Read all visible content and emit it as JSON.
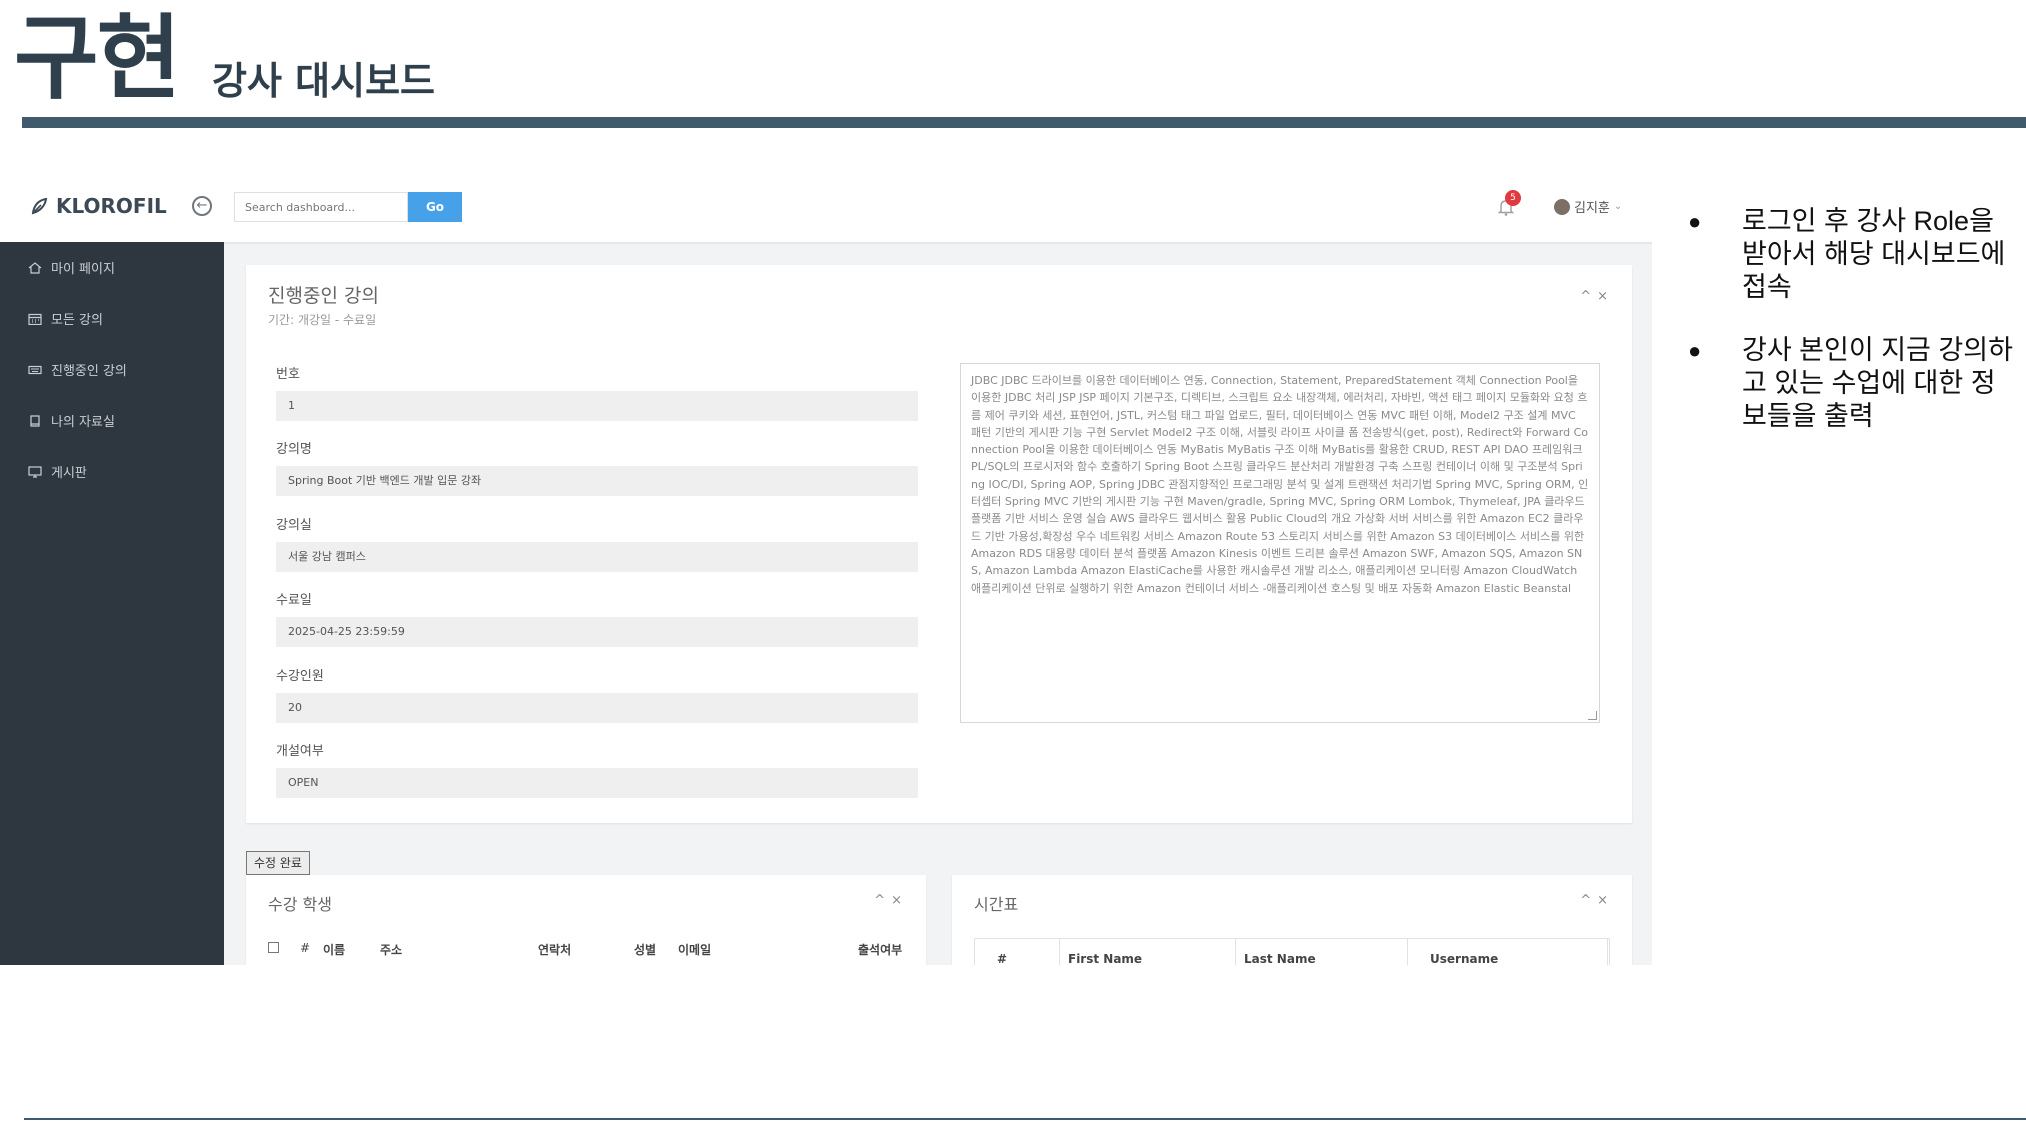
{
  "slide": {
    "title": "구현",
    "subtitle": "강사 대시보드",
    "bullets": [
      "로그인 후 강사 Role을 받아서 해당 대시보드에 접속",
      "강사 본인이 지금 강의하고 있는 수업에 대한 정보들을 출력"
    ]
  },
  "topnav": {
    "logo": "KLOROFIL",
    "search_placeholder": "Search dashboard...",
    "go_label": "Go",
    "notification_count": "5",
    "user_name": "김지훈"
  },
  "sidebar": {
    "items": [
      {
        "label": "마이 페이지",
        "icon": "home-icon"
      },
      {
        "label": "모든 강의",
        "icon": "calendar-icon"
      },
      {
        "label": "진행중인 강의",
        "icon": "keyboard-icon"
      },
      {
        "label": "나의 자료실",
        "icon": "book-icon"
      },
      {
        "label": "게시판",
        "icon": "monitor-icon"
      }
    ]
  },
  "course_panel": {
    "title": "진행중인 강의",
    "subtitle": "기간: 개강일 - 수료일",
    "fields": [
      {
        "label": "번호",
        "value": "1"
      },
      {
        "label": "강의명",
        "value": "Spring Boot 기반 백엔드 개발 입문 강좌"
      },
      {
        "label": "강의실",
        "value": "서울 강남 캠퍼스"
      },
      {
        "label": "수료일",
        "value": "2025-04-25 23:59:59"
      },
      {
        "label": "수강인원",
        "value": "20"
      },
      {
        "label": "개설여부",
        "value": "OPEN"
      }
    ],
    "curriculum": "JDBC JDBC 드라이브를 이용한 데이터베이스 연동, Connection, Statement, PreparedStatement 객체 Connection Pool을 이용한 JDBC 처리    JSP  JSP 페이지 기본구조, 디렉티브, 스크립트 요소    내장객체, 에러처리, 자바빈, 액션 태그    페이지 모듈화와 요청 흐름 제어    쿠키와 세션, 표현언어, JSTL, 커스텀 태그    파일 업로드, 필터, 데이터베이스 연동    MVC 패턴 이해, Model2 구조 설계    MVC 패턴 기반의 게시판 기능 구현    Servlet  Model2 구조 이해, 서블릿 라이프 사이클    폼 전송방식(get, post), Redirect와 Forward    Connection Pool을 이용한 데이터베이스 연동    MyBatis  MyBatis 구조 이해    MyBatis를 활용한 CRUD, REST API    DAO 프레임워크    PL/SQL의 프로시저와 함수 호출하기    Spring Boot  스프링 클라우드 분산처리 개발환경 구축    스프링 컨테이너 이해 및 구조분석    Spring IOC/DI, Spring AOP, Spring JDBC    관점지향적인 프로그래밍 분석 및 설계    트랜잭션 처리기법    Spring MVC, Spring ORM, 인터셉터    Spring MVC 기반의 게시판 기능 구현    Maven/gradle, Spring MVC, Spring ORM    Lombok, Thymeleaf, JPA    클라우드 플랫폼 기반 서비스 운영 실습  AWS 클라우드 웹서비스 활용  Public Cloud의 개요    가상화 서버 서비스를 위한 Amazon EC2    클라우드 기반 가용성,확장성 우수 네트워킹 서비스 Amazon Route 53    스토리지 서비스를 위한 Amazon S3    데이터베이스 서비스를 위한 Amazon RDS    대용량 데이터 분석 플랫폼 Amazon Kinesis    이벤트 드리븐 솔루션 Amazon SWF, Amazon SQS, Amazon SNS, Amazon Lambda    Amazon ElastiCache를 사용한 캐시솔루션 개발    리소스, 애플리케이션 모니터링 Amazon CloudWatch    애플리케이션 단위로 실행하기 위한 Amazon 컨테이너 서비스    -애플리케이션 호스팅 및 배포 자동화 Amazon Elastic Beanstal"
  },
  "done_button": "수정 완료",
  "students_panel": {
    "title": "수강 학생",
    "columns": [
      "#",
      "이름",
      "주소",
      "연락처",
      "성별",
      "이메일",
      "출석여부"
    ]
  },
  "schedule_panel": {
    "title": "시간표",
    "columns": [
      "#",
      "First Name",
      "Last Name",
      "Username"
    ]
  },
  "panel_controls": {
    "collapse": "^",
    "close": "×"
  }
}
